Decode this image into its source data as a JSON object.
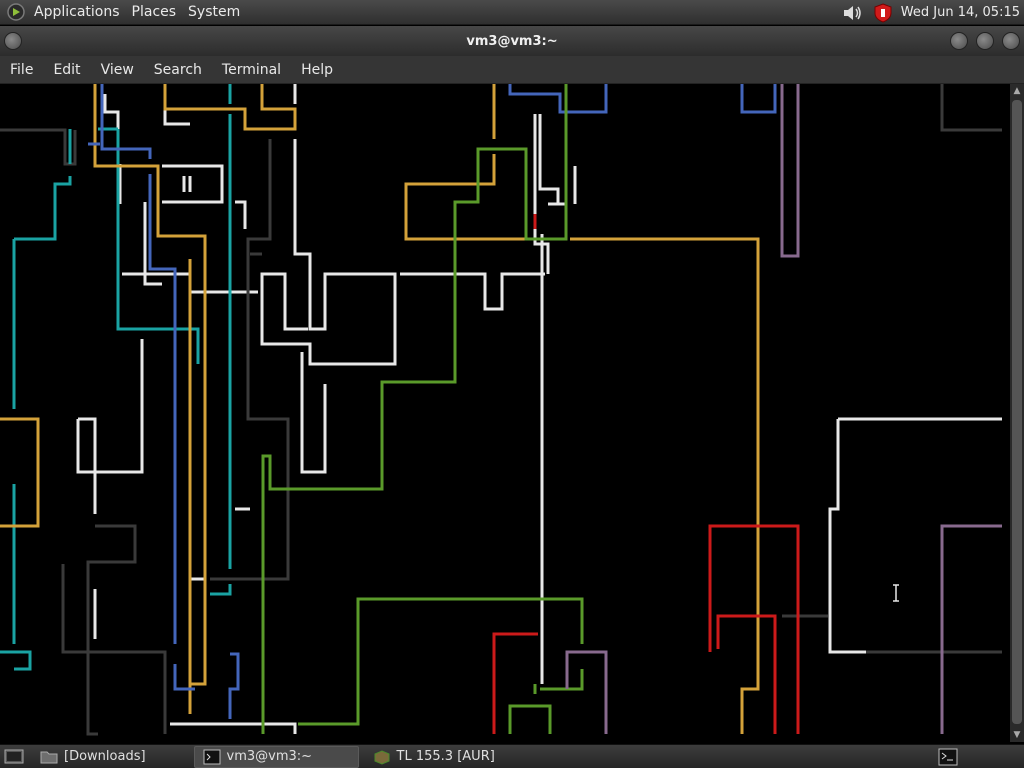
{
  "top_panel": {
    "menus": [
      "Applications",
      "Places",
      "System"
    ],
    "clock": "Wed Jun 14, 05:15",
    "icons": [
      "volume-icon",
      "shield-icon"
    ]
  },
  "window": {
    "title": "vm3@vm3:~"
  },
  "menubar": {
    "items": [
      "File",
      "Edit",
      "View",
      "Search",
      "Terminal",
      "Help"
    ]
  },
  "taskbar": {
    "items": [
      {
        "label": "[Downloads]",
        "icon": "folder-icon",
        "active": false
      },
      {
        "label": "vm3@vm3:~",
        "icon": "terminal-icon",
        "active": true
      },
      {
        "label": "TL 155.3 [AUR]",
        "icon": "package-icon",
        "active": false
      }
    ]
  },
  "colors": {
    "white": "#e8e8e8",
    "gray": "#3a3a3a",
    "teal": "#1aa3a3",
    "yellow": "#d4a23a",
    "blue": "#4466bb",
    "green": "#5a9a2a",
    "red": "#cc1a1a",
    "purple": "#886a8e"
  }
}
